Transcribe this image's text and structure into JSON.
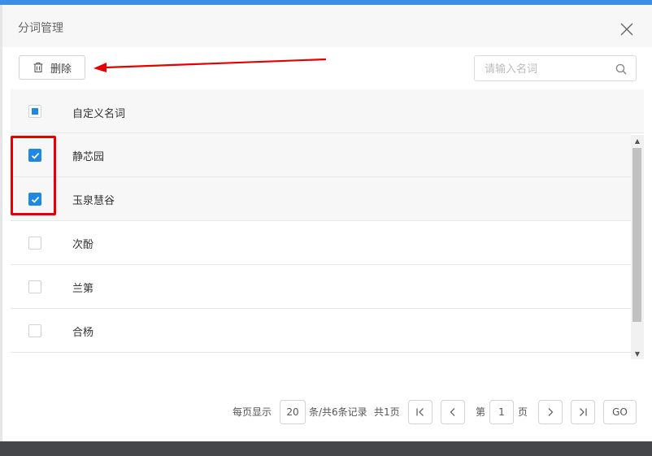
{
  "dialog": {
    "title": "分词管理"
  },
  "toolbar": {
    "delete_label": "删除"
  },
  "search": {
    "placeholder": "请输入名词",
    "value": ""
  },
  "table": {
    "header": "自定义名词",
    "rows": [
      {
        "label": "静芯园",
        "checked": true
      },
      {
        "label": "玉泉慧谷",
        "checked": true
      },
      {
        "label": "次酚",
        "checked": false
      },
      {
        "label": "兰第",
        "checked": false
      },
      {
        "label": "合杨",
        "checked": false
      }
    ]
  },
  "pagination": {
    "per_page_prefix": "每页显示",
    "per_page": "20",
    "records_text": "条/共6条记录",
    "total_pages_text": "共1页",
    "page_prefix": "第",
    "current_page": "1",
    "page_suffix": "页",
    "go_label": "GO"
  },
  "icons": {
    "close": "close-icon",
    "delete": "trash-icon",
    "search": "search-icon",
    "first": "first-page-icon",
    "prev": "prev-page-icon",
    "next": "next-page-icon",
    "last": "last-page-icon"
  },
  "colors": {
    "accent": "#1e88e5",
    "top_bar": "#3a8ee6",
    "annotation": "#e60000"
  }
}
